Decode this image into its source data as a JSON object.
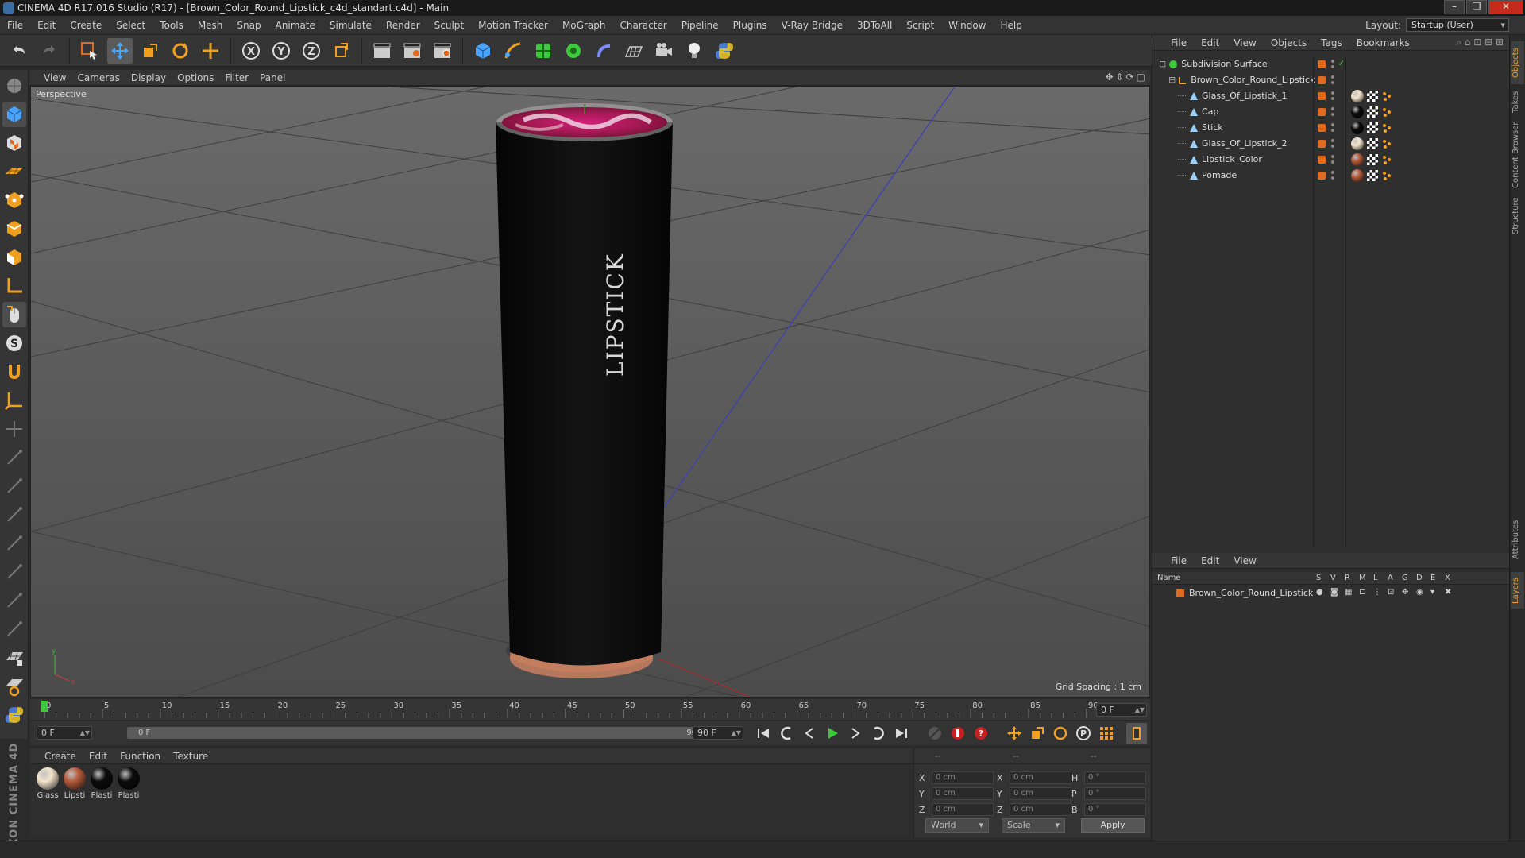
{
  "window": {
    "title": "CINEMA 4D R17.016 Studio (R17) - [Brown_Color_Round_Lipstick_c4d_standart.c4d] - Main",
    "minimize": "–",
    "restore": "❐",
    "close": "✕"
  },
  "menu": [
    "File",
    "Edit",
    "Create",
    "Select",
    "Tools",
    "Mesh",
    "Snap",
    "Animate",
    "Simulate",
    "Render",
    "Sculpt",
    "Motion Tracker",
    "MoGraph",
    "Character",
    "Pipeline",
    "Plugins",
    "V-Ray Bridge",
    "3DToAll",
    "Script",
    "Window",
    "Help"
  ],
  "layout": {
    "label": "Layout:",
    "value": "Startup (User)"
  },
  "viewport": {
    "menu": [
      "View",
      "Cameras",
      "Display",
      "Options",
      "Filter",
      "Panel"
    ],
    "label": "Perspective",
    "grid_spacing": "Grid Spacing : 1 cm",
    "product_text": "LIPSTICK",
    "axis_y": "y",
    "axis_x": "x"
  },
  "timeline": {
    "ticks": [
      "0",
      "5",
      "10",
      "15",
      "20",
      "25",
      "30",
      "35",
      "40",
      "45",
      "50",
      "55",
      "60",
      "65",
      "70",
      "75",
      "80",
      "85",
      "90"
    ],
    "current_frame": "0 F",
    "start_field": "0 F",
    "range_start": "0 F",
    "range_end": "90 F",
    "end_field": "90 F",
    "playhead_fraction": 0.0
  },
  "materials": {
    "menu": [
      "Create",
      "Edit",
      "Function",
      "Texture"
    ],
    "items": [
      {
        "name": "Glass",
        "color": "#f4e4cc"
      },
      {
        "name": "Lipsti",
        "color": "#b55a3a"
      },
      {
        "name": "Plasti",
        "color": "#0c0c0c"
      },
      {
        "name": "Plasti",
        "color": "#0c0c0c"
      }
    ]
  },
  "coordinates": {
    "headers": [
      "--",
      "--",
      "--"
    ],
    "rows": [
      {
        "a_label": "X",
        "a_val": "0 cm",
        "b_label": "X",
        "b_val": "0 cm",
        "c_label": "H",
        "c_val": "0 °"
      },
      {
        "a_label": "Y",
        "a_val": "0 cm",
        "b_label": "Y",
        "b_val": "0 cm",
        "c_label": "P",
        "c_val": "0 °"
      },
      {
        "a_label": "Z",
        "a_val": "0 cm",
        "b_label": "Z",
        "b_val": "0 cm",
        "c_label": "B",
        "c_val": "0 °"
      }
    ],
    "mode_world": "World",
    "mode_scale": "Scale",
    "apply": "Apply"
  },
  "objects_panel": {
    "menu": [
      "File",
      "Edit",
      "View",
      "Objects",
      "Tags",
      "Bookmarks"
    ],
    "tree": [
      {
        "name": "Subdivision Surface",
        "level": 0,
        "icon": "subdivision-icon"
      },
      {
        "name": "Brown_Color_Round_Lipstick",
        "level": 1,
        "icon": "null-icon"
      },
      {
        "name": "Glass_Of_Lipstick_1",
        "level": 2,
        "icon": "polygon-icon",
        "mat": "#f4e4cc"
      },
      {
        "name": "Cap",
        "level": 2,
        "icon": "polygon-icon",
        "mat": "#0c0c0c"
      },
      {
        "name": "Stick",
        "level": 2,
        "icon": "polygon-icon",
        "mat": "#0c0c0c"
      },
      {
        "name": "Glass_Of_Lipstick_2",
        "level": 2,
        "icon": "polygon-icon",
        "mat": "#f4e4cc"
      },
      {
        "name": "Lipstick_Color",
        "level": 2,
        "icon": "polygon-icon",
        "mat": "#b55a3a"
      },
      {
        "name": "Pomade",
        "level": 2,
        "icon": "polygon-icon",
        "mat": "#b55a3a"
      }
    ]
  },
  "layers_panel": {
    "menu": [
      "File",
      "Edit",
      "View"
    ],
    "columns": [
      "Name",
      "S",
      "V",
      "R",
      "M",
      "L",
      "A",
      "G",
      "D",
      "E",
      "X"
    ],
    "rows": [
      {
        "name": "Brown_Color_Round_Lipstick"
      }
    ]
  },
  "side_tabs": [
    "Objects",
    "Takes",
    "Content Browser",
    "Structure",
    "Attributes",
    "Layers"
  ],
  "colors": {
    "accent": "#e06a20",
    "active_tab": "#e0a040",
    "select": "#5a5a5a"
  }
}
